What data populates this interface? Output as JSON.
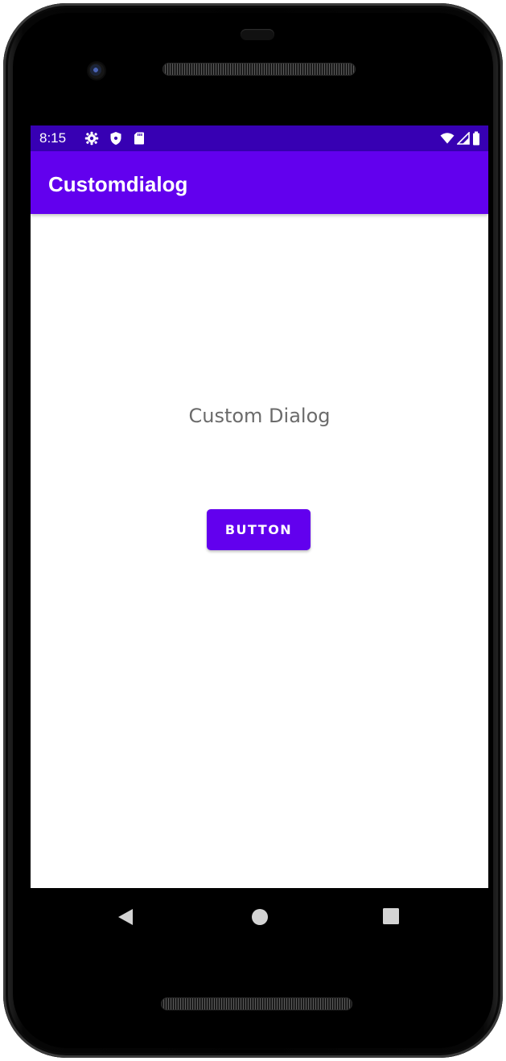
{
  "status_bar": {
    "time": "8:15",
    "icons": {
      "left": [
        "settings-icon",
        "shield-icon",
        "sd-card-icon"
      ],
      "right": [
        "wifi-icon",
        "signal-icon",
        "battery-icon"
      ]
    }
  },
  "app_bar": {
    "title": "Customdialog"
  },
  "main": {
    "text": "Custom Dialog",
    "button_label": "BUTTON"
  },
  "nav_bar": {
    "icons": [
      "back-icon",
      "home-icon",
      "recents-icon"
    ]
  },
  "colors": {
    "status_bar": "#3700b3",
    "primary": "#6200ee",
    "content_text": "#6b6b6b",
    "screen_background": "#ffffff",
    "device_body": "#000000",
    "nav_icon": "#d4d4d4"
  }
}
